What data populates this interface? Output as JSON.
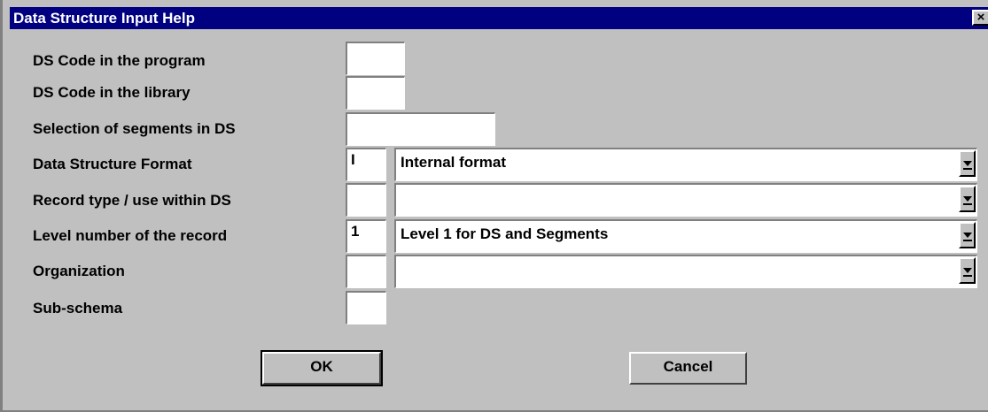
{
  "window": {
    "title": "Data Structure Input Help",
    "close_glyph": "×"
  },
  "fields": {
    "ds_code_program": {
      "label": "DS Code in the program",
      "value": ""
    },
    "ds_code_library": {
      "label": "DS Code in the library",
      "value": ""
    },
    "segment_selection": {
      "label": "Selection of segments in DS",
      "value": ""
    },
    "ds_format": {
      "label": "Data Structure Format",
      "value": "I",
      "selected": "Internal format"
    },
    "record_type": {
      "label": "Record type / use within DS",
      "value": "",
      "selected": ""
    },
    "level_number": {
      "label": "Level number of the record",
      "value": "1",
      "selected": "Level 1 for DS and Segments"
    },
    "organization": {
      "label": "Organization",
      "value": "",
      "selected": ""
    },
    "sub_schema": {
      "label": "Sub-schema",
      "value": ""
    }
  },
  "buttons": {
    "ok": "OK",
    "cancel": "Cancel"
  },
  "icons": {
    "close": "close-icon",
    "dropdown": "chevron-down-icon"
  }
}
